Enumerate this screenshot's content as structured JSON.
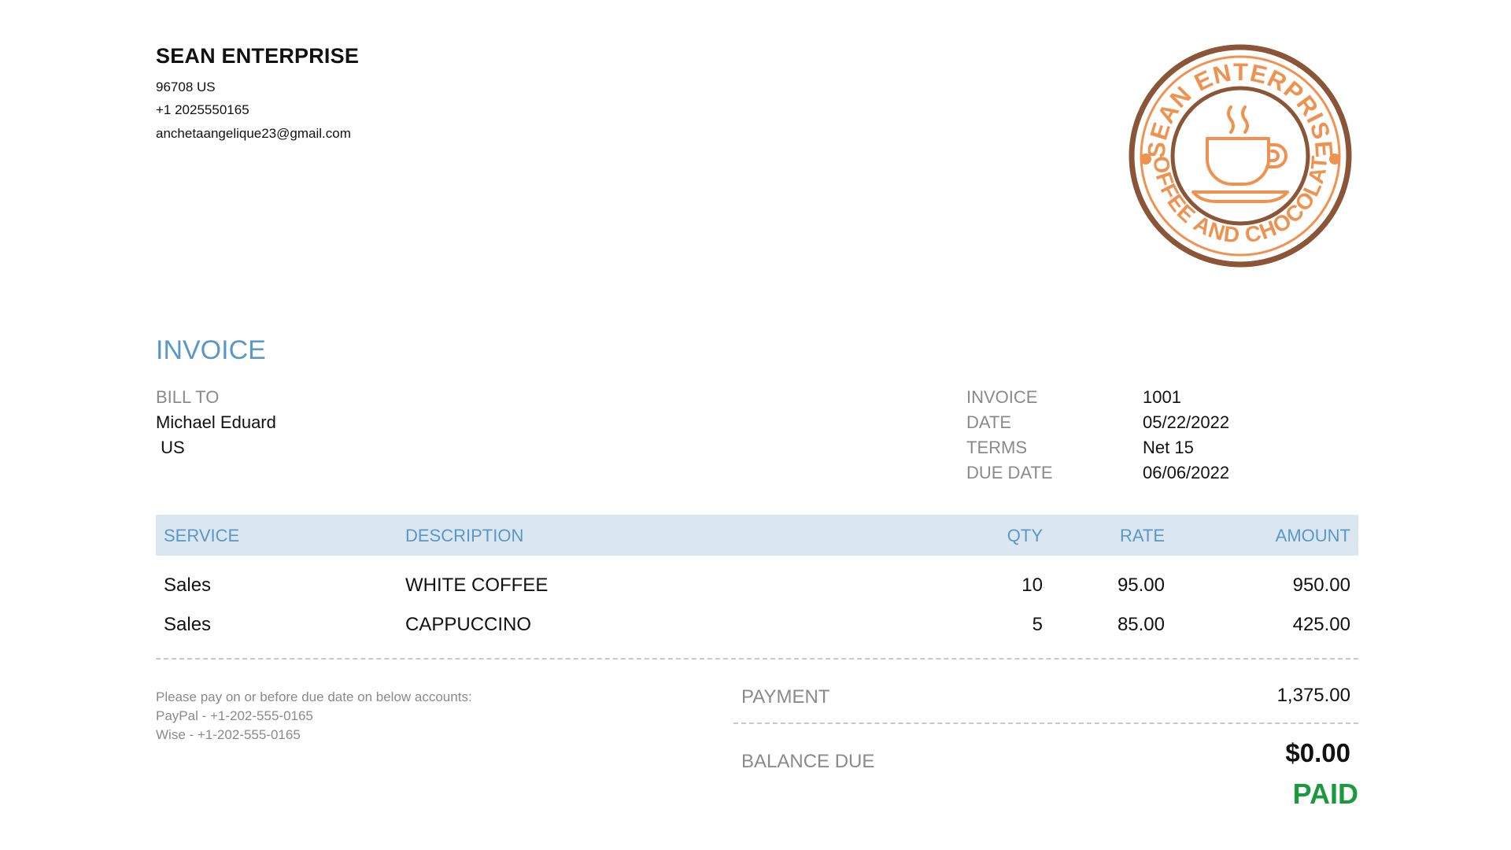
{
  "company": {
    "name": "SEAN ENTERPRISE",
    "address": "96708 US",
    "phone": "+1 2025550165",
    "email": "anchetaangelique23@gmail.com"
  },
  "logo": {
    "top_text": "SEAN ENTERPRISE",
    "bottom_text": "COFFEE AND CHOCOLATE",
    "icon": "coffee-cup-icon",
    "ring_color": "#8b5637",
    "accent_color": "#f0924f"
  },
  "invoice": {
    "title": "INVOICE",
    "bill_to_label": "BILL TO",
    "bill_to_name": "Michael Eduard",
    "bill_to_country": " US",
    "meta": [
      {
        "label": "INVOICE",
        "value": "1001"
      },
      {
        "label": "DATE",
        "value": "05/22/2022"
      },
      {
        "label": "TERMS",
        "value": "Net 15"
      },
      {
        "label": "DUE DATE",
        "value": "06/06/2022"
      }
    ]
  },
  "table": {
    "headers": {
      "service": "SERVICE",
      "description": "DESCRIPTION",
      "qty": "QTY",
      "rate": "RATE",
      "amount": "AMOUNT"
    },
    "rows": [
      {
        "service": "Sales",
        "description": "WHITE COFFEE",
        "qty": "10",
        "rate": "95.00",
        "amount": "950.00"
      },
      {
        "service": "Sales",
        "description": "CAPPUCCINO",
        "qty": "5",
        "rate": "85.00",
        "amount": "425.00"
      }
    ]
  },
  "payment_note": {
    "line1": "Please pay on or before due date on below accounts:",
    "line2": "PayPal - +1-202-555-0165",
    "line3": "Wise - +1-202-555-0165"
  },
  "summary": {
    "payment_label": "PAYMENT",
    "payment_value": "1,375.00",
    "balance_label": "BALANCE DUE",
    "balance_value": "$0.00",
    "status": "PAID",
    "status_color": "#1a9a3c"
  }
}
